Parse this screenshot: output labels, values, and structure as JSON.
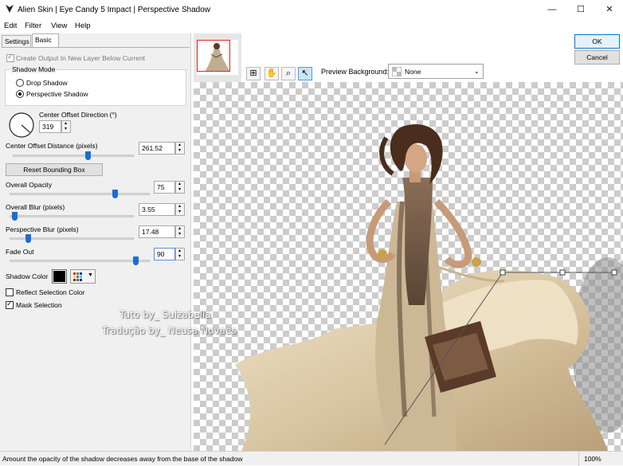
{
  "window": {
    "title": "Alien Skin | Eye Candy 5 Impact | Perspective Shadow",
    "minimize_icon": "minimize-icon",
    "maximize_icon": "maximize-icon",
    "close_icon": "close-icon"
  },
  "menu": [
    "Edit",
    "Filter",
    "View",
    "Help"
  ],
  "tabs": {
    "settings": "Settings",
    "basic": "Basic"
  },
  "panel": {
    "create_output_label": "Create Output In New Layer Below Current",
    "create_output_checked": true,
    "shadow_mode_label": "Shadow Mode",
    "drop_shadow_label": "Drop Shadow",
    "perspective_shadow_label": "Perspective Shadow",
    "selected_mode": "Perspective Shadow",
    "center_offset_direction_label": "Center Offset Direction (°)",
    "center_offset_direction_value": "319",
    "center_offset_distance_label": "Center Offset Distance (pixels)",
    "center_offset_distance_value": "261.52",
    "center_offset_distance_slider": 0.62,
    "reset_bounding_box_label": "Reset Bounding Box",
    "overall_opacity_label": "Overall Opacity",
    "overall_opacity_value": "75",
    "overall_opacity_slider": 0.75,
    "overall_blur_label": "Overall Blur (pixels)",
    "overall_blur_value": "3.55",
    "overall_blur_slider": 0.04,
    "perspective_blur_label": "Perspective Blur (pixels)",
    "perspective_blur_value": "17.48",
    "perspective_blur_slider": 0.15,
    "fade_out_label": "Fade Out",
    "fade_out_value": "90",
    "fade_out_slider": 0.9,
    "shadow_color_label": "Shadow Color",
    "shadow_color": "#000000",
    "reflect_selection_color_label": "Reflect Selection Color",
    "reflect_selection_color_checked": false,
    "mask_selection_label": "Mask Selection",
    "mask_selection_checked": true
  },
  "toolbar": {
    "preview_background_label": "Preview Background:",
    "preview_background_value": "None",
    "tools": [
      "zoom-to-fit-icon",
      "hand-icon",
      "zoom-icon",
      "arrow-select-icon"
    ]
  },
  "buttons": {
    "ok": "OK",
    "cancel": "Cancel"
  },
  "watermarks": [
    "Tuto by_ Suizabella",
    "Tradução by_ Neusa Novaes"
  ],
  "status": {
    "message": "Amount the opacity of the shadow decreases away from the base of the shadow",
    "zoom": "100%"
  },
  "colors": {
    "accent": "#1a6ed1",
    "checker": "#cccccc",
    "panel": "#f0f0f0"
  }
}
